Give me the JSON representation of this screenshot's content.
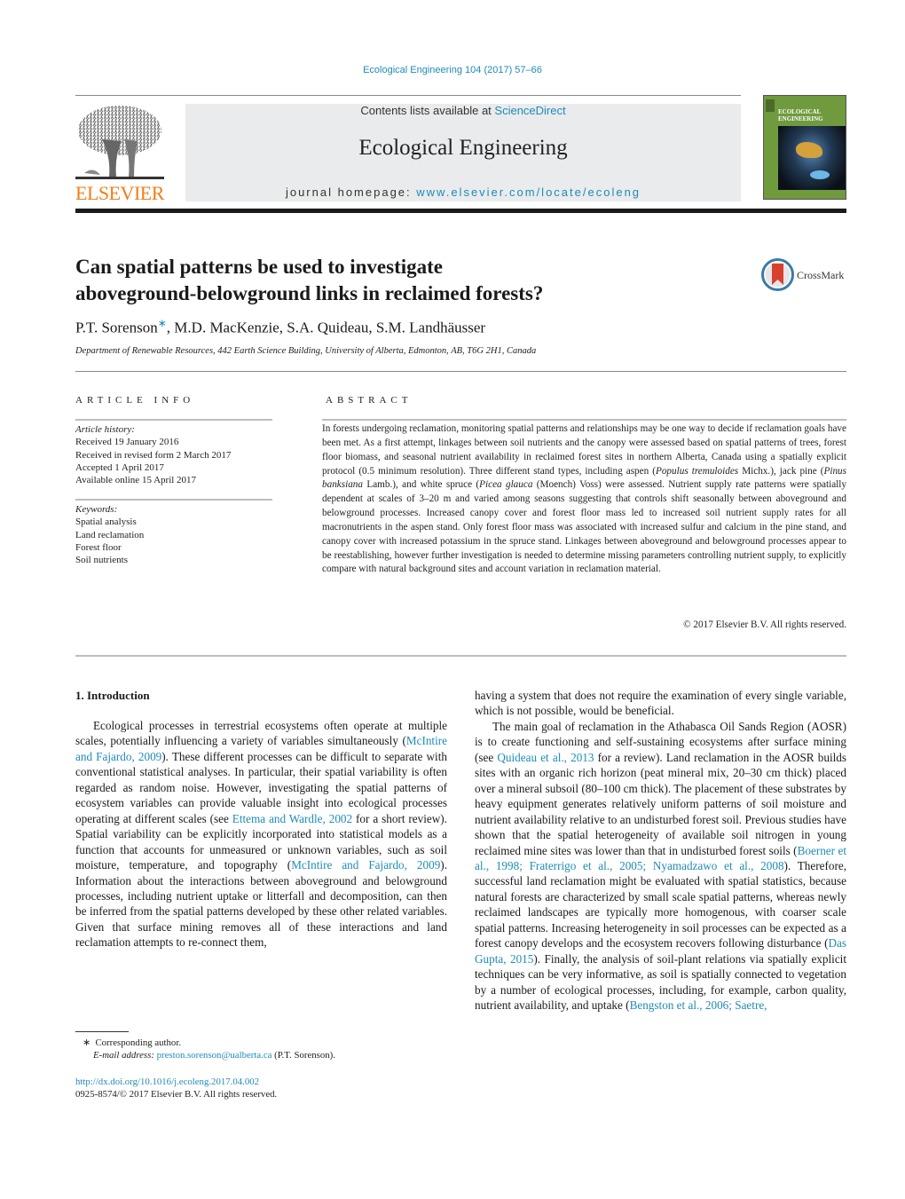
{
  "header": {
    "journal_ref": "Ecological Engineering 104 (2017) 57–66",
    "contents_prefix": "Contents lists available at ",
    "contents_link": "ScienceDirect",
    "journal_title": "Ecological Engineering",
    "homepage_prefix": "journal homepage: ",
    "homepage_link": "www.elsevier.com/locate/ecoleng",
    "publisher_wordmark": "ELSEVIER",
    "cover_title_line1": "ECOLOGICAL",
    "cover_title_line2": "ENGINEERING"
  },
  "article": {
    "title_line1": "Can spatial patterns be used to investigate",
    "title_line2": "aboveground-belowground links in reclaimed forests?",
    "crossmark_label": "CrossMark",
    "authors": [
      {
        "name": "P.T. Sorenson",
        "corresponding": "∗"
      },
      {
        "name": ", M.D. MacKenzie, S.A. Quideau, S.M. Landhäusser"
      }
    ],
    "affiliation": "Department of Renewable Resources, 442 Earth Science Building, University of Alberta, Edmonton, AB, T6G 2H1, Canada"
  },
  "article_info": {
    "label": "ARTICLE INFO",
    "history_head": "Article history:",
    "history": [
      "Received 19 January 2016",
      "Received in revised form 2 March 2017",
      "Accepted 1 April 2017",
      "Available online 15 April 2017"
    ],
    "keywords_head": "Keywords:",
    "keywords": [
      "Spatial analysis",
      "Land reclamation",
      "Forest floor",
      "Soil nutrients"
    ]
  },
  "abstract": {
    "label": "ABSTRACT",
    "parts": {
      "p1": "In forests undergoing reclamation, monitoring spatial patterns and relationships may be one way to decide if reclamation goals have been met. As a first attempt, linkages between soil nutrients and the canopy were assessed based on spatial patterns of trees, forest floor biomass, and seasonal nutrient availability in reclaimed forest sites in northern Alberta, Canada using a spatially explicit protocol (0.5 minimum resolution). Three different stand types, including aspen (",
      "sp1": "Populus tremuloides",
      "p2": " Michx.), jack pine (",
      "sp2": "Pinus banksiana",
      "p3": " Lamb.), and white spruce (",
      "sp3": "Picea glauca",
      "p4": " (Moench) Voss) were assessed. Nutrient supply rate patterns were spatially dependent at scales of 3–20 m and varied among seasons suggesting that controls shift seasonally between aboveground and belowground processes. Increased canopy cover and forest floor mass led to increased soil nutrient supply rates for all macronutrients in the aspen stand. Only forest floor mass was associated with increased sulfur and calcium in the pine stand, and canopy cover with increased potassium in the spruce stand. Linkages between aboveground and belowground processes appear to be reestablishing, however further investigation is needed to determine missing parameters controlling nutrient supply, to explicitly compare with natural background sites and account variation in reclamation material."
    },
    "copyright": "© 2017 Elsevier B.V. All rights reserved."
  },
  "introduction": {
    "heading": "1.  Introduction",
    "left": {
      "t1": "Ecological processes in terrestrial ecosystems often operate at multiple scales, potentially influencing a variety of variables simultaneously (",
      "c1": "McIntire and Fajardo, 2009",
      "t2": "). These different processes can be difficult to separate with conventional statistical analyses. In particular, their spatial variability is often regarded as random noise. However, investigating the spatial patterns of ecosystem variables can provide valuable insight into ecological processes operating at different scales (see ",
      "c2": "Ettema and Wardle, 2002",
      "t3": " for a short review). Spatial variability can be explicitly incorporated into statistical models as a function that accounts for unmeasured or unknown variables, such as soil moisture, temperature, and topography (",
      "c3": "McIntire and Fajardo, 2009",
      "t4": "). Information about the interactions between aboveground and belowground processes, including nutrient uptake or litterfall and decomposition, can then be inferred from the spatial patterns developed by these other related variables. Given that surface mining removes all of these interactions and land reclamation attempts to re-connect them,"
    },
    "right": {
      "p0": "having a system that does not require the examination of every single variable, which is not possible, would be beneficial.",
      "t1": "The main goal of reclamation in the Athabasca Oil Sands Region (AOSR) is to create functioning and self-sustaining ecosystems after surface mining (see ",
      "c1": "Quideau et al., 2013",
      "t2": " for a review). Land reclamation in the AOSR builds sites with an organic rich horizon (peat mineral mix, 20–30 cm thick) placed over a mineral subsoil (80–100 cm thick). The placement of these substrates by heavy equipment generates relatively uniform patterns of soil moisture and nutrient availability relative to an undisturbed forest soil. Previous studies have shown that the spatial heterogeneity of available soil nitrogen in young reclaimed mine sites was lower than that in undisturbed forest soils (",
      "c2": "Boerner et al., 1998; Fraterrigo et al., 2005; Nyamadzawo et al., 2008",
      "t3": "). Therefore, successful land reclamation might be evaluated with spatial statistics, because natural forests are characterized by small scale spatial patterns, whereas newly reclaimed landscapes are typically more homogenous, with coarser scale spatial patterns. Increasing heterogeneity in soil processes can be expected as a forest canopy develops and the ecosystem recovers following disturbance (",
      "c3": "Das Gupta, 2015",
      "t4": "). Finally, the analysis of soil-plant relations via spatially explicit techniques can be very informative, as soil is spatially connected to vegetation by a number of ecological processes, including, for example, carbon quality, nutrient availability, and uptake (",
      "c4": "Bengston et al., 2006; Saetre,"
    }
  },
  "footnotes": {
    "star": "∗",
    "corresponding": "Corresponding author.",
    "email_label": "E-mail address:",
    "email": "preston.sorenson@ualberta.ca",
    "email_owner": " (P.T. Sorenson).",
    "doi": "http://dx.doi.org/10.1016/j.ecoleng.2017.04.002",
    "issn": "0925-8574/© 2017 Elsevier B.V. All rights reserved."
  },
  "colors": {
    "link": "#1f8bb8",
    "elsevier_orange": "#f07d1a",
    "masthead_bg": "#e9ebec",
    "crossmark_red": "#d9412f"
  }
}
